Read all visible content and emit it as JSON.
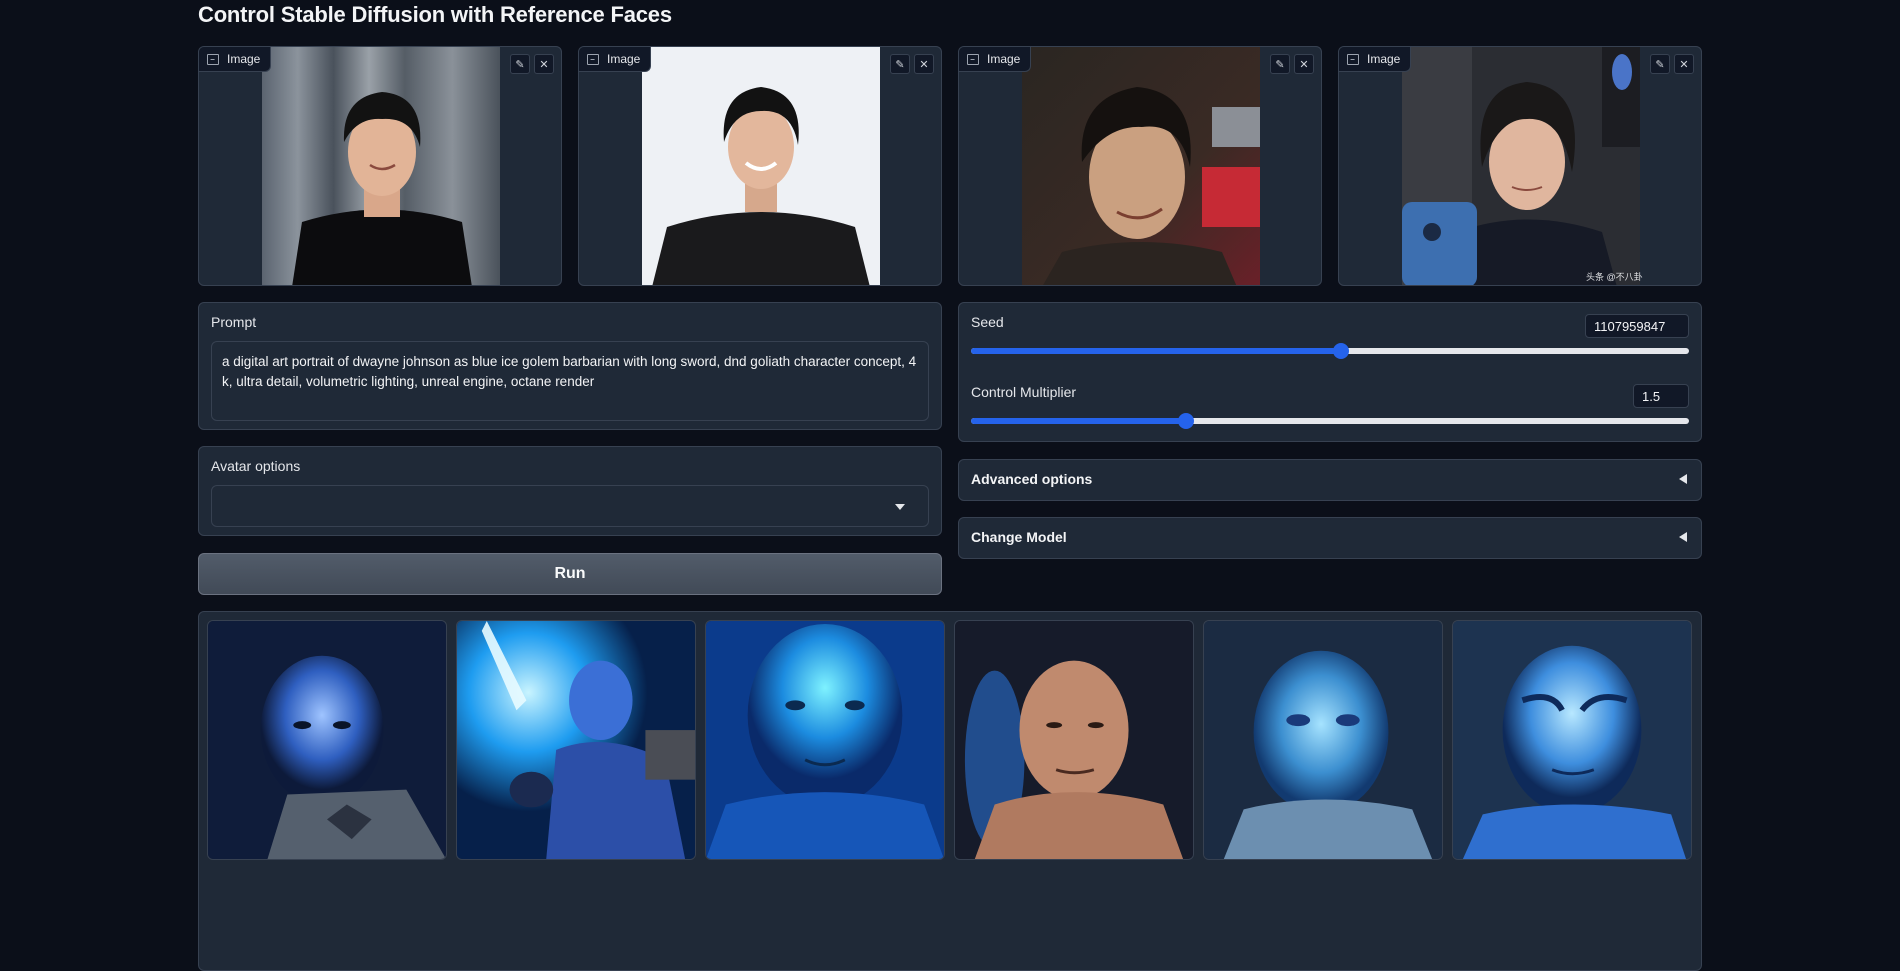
{
  "page": {
    "title": "Control Stable Diffusion with Reference Faces"
  },
  "inputs": {
    "image_label": "Image",
    "edit_icon": "pencil-icon",
    "clear_icon": "close-icon",
    "images": [
      {
        "label": "Image"
      },
      {
        "label": "Image"
      },
      {
        "label": "Image"
      },
      {
        "label": "Image",
        "watermark": "头条 @不八卦"
      }
    ]
  },
  "prompt": {
    "label": "Prompt",
    "value": "a digital art portrait of dwayne johnson as blue ice golem barbarian with long sword, dnd goliath character concept, 4 k, ultra detail, volumetric lighting, unreal engine, octane render"
  },
  "avatar": {
    "label": "Avatar options",
    "value": ""
  },
  "run": {
    "label": "Run"
  },
  "seed": {
    "label": "Seed",
    "value": "1107959847",
    "fraction": 0.516
  },
  "control": {
    "label": "Control Multiplier",
    "value": "1.5",
    "fraction": 0.3
  },
  "advanced": {
    "label": "Advanced options"
  },
  "change_model": {
    "label": "Change Model"
  },
  "gallery": {
    "count": 6
  },
  "colors": {
    "accent": "#2563eb",
    "background": "#0b0f19",
    "panel": "#1f2937"
  }
}
